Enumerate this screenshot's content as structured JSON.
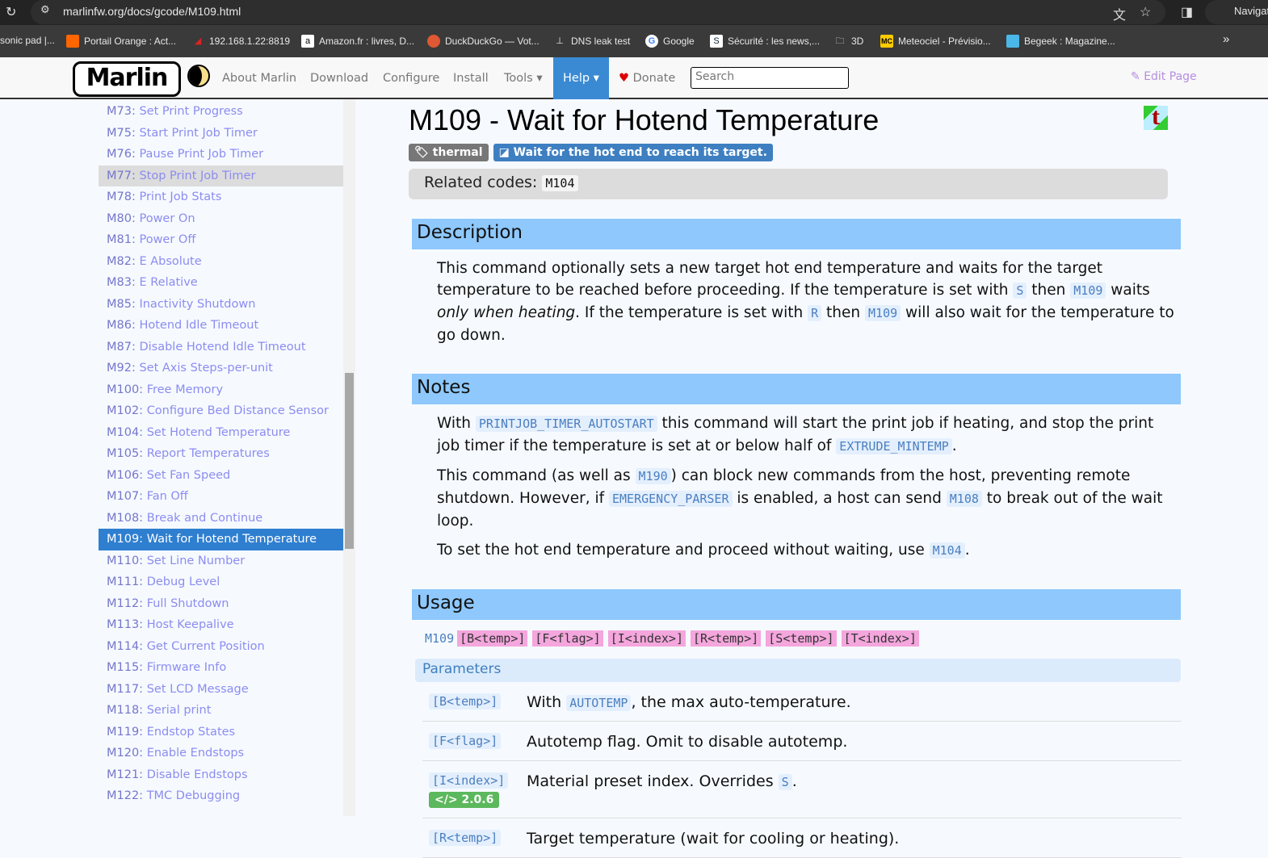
{
  "browser": {
    "url": "marlinfw.org/docs/gcode/M109.html",
    "profile_label": "Navigat",
    "bookmarks": [
      {
        "label": "sonic pad |..."
      },
      {
        "label": "Portail Orange : Act..."
      },
      {
        "label": "192.168.1.22:8819"
      },
      {
        "label": "Amazon.fr : livres, D..."
      },
      {
        "label": "DuckDuckGo — Vot..."
      },
      {
        "label": "DNS leak test"
      },
      {
        "label": "Google"
      },
      {
        "label": "Sécurité : les news,..."
      },
      {
        "label": "3D"
      },
      {
        "label": "Meteociel - Prévisio..."
      },
      {
        "label": "Begeek : Magazine..."
      }
    ],
    "more": "»"
  },
  "nav": {
    "logo": "Marlin",
    "items": [
      "About Marlin",
      "Download",
      "Configure",
      "Install",
      "Tools ▾"
    ],
    "help": "Help ▾",
    "donate": "Donate",
    "search_placeholder": "Search",
    "edit": "Edit Page"
  },
  "sidebar": [
    [
      "M73:",
      "Set Print Progress"
    ],
    [
      "M75:",
      "Start Print Job Timer"
    ],
    [
      "M76:",
      "Pause Print Job Timer"
    ],
    [
      "M77:",
      "Stop Print Job Timer"
    ],
    [
      "M78:",
      "Print Job Stats"
    ],
    [
      "M80:",
      "Power On"
    ],
    [
      "M81:",
      "Power Off"
    ],
    [
      "M82:",
      "E Absolute"
    ],
    [
      "M83:",
      "E Relative"
    ],
    [
      "M85:",
      "Inactivity Shutdown"
    ],
    [
      "M86:",
      "Hotend Idle Timeout"
    ],
    [
      "M87:",
      "Disable Hotend Idle Timeout"
    ],
    [
      "M92:",
      "Set Axis Steps-per-unit"
    ],
    [
      "M100:",
      "Free Memory"
    ],
    [
      "M102:",
      "Configure Bed Distance Sensor"
    ],
    [
      "M104:",
      "Set Hotend Temperature"
    ],
    [
      "M105:",
      "Report Temperatures"
    ],
    [
      "M106:",
      "Set Fan Speed"
    ],
    [
      "M107:",
      "Fan Off"
    ],
    [
      "M108:",
      "Break and Continue"
    ],
    [
      "M109:",
      "Wait for Hotend Temperature"
    ],
    [
      "M110:",
      "Set Line Number"
    ],
    [
      "M111:",
      "Debug Level"
    ],
    [
      "M112:",
      "Full Shutdown"
    ],
    [
      "M113:",
      "Host Keepalive"
    ],
    [
      "M114:",
      "Get Current Position"
    ],
    [
      "M115:",
      "Firmware Info"
    ],
    [
      "M117:",
      "Set LCD Message"
    ],
    [
      "M118:",
      "Serial print"
    ],
    [
      "M119:",
      "Endstop States"
    ],
    [
      "M120:",
      "Enable Endstops"
    ],
    [
      "M121:",
      "Disable Endstops"
    ],
    [
      "M122:",
      "TMC Debugging"
    ]
  ],
  "page": {
    "title": "M109 - Wait for Hotend Temperature",
    "tag": "thermal",
    "summary": "Wait for the hot end to reach its target.",
    "related_label": "Related codes:",
    "related_code": "M104",
    "desc_h": "Description",
    "desc": [
      "This command optionally sets a new target hot end temperature and waits for the target temperature to be reached before proceeding. If the temperature is set with ",
      "S",
      " then ",
      "M109",
      " waits ",
      "only when heating",
      ". If the temperature is set with ",
      "R",
      " then ",
      "M109",
      " will also wait for the temperature to go down."
    ],
    "notes_h": "Notes",
    "n1": [
      "With ",
      "PRINTJOB_TIMER_AUTOSTART",
      " this command will start the print job if heating, and stop the print job timer if the temperature is set at or below half of ",
      "EXTRUDE_MINTEMP",
      "."
    ],
    "n2": [
      "This command (as well as ",
      "M190",
      ") can block new commands from the host, preventing remote shutdown. However, if ",
      "EMERGENCY_PARSER",
      " is enabled, a host can send ",
      "M108",
      " to break out of the wait loop."
    ],
    "n3": [
      "To set the hot end temperature and proceed without waiting, use ",
      "M104",
      "."
    ],
    "usage_h": "Usage",
    "usage_cmd": "M109",
    "usage_args": [
      "[B<temp>]",
      "[F<flag>]",
      "[I<index>]",
      "[R<temp>]",
      "[S<temp>]",
      "[T<index>]"
    ],
    "params_h": "Parameters",
    "params": [
      {
        "name": "[B<temp>]",
        "d": [
          "With ",
          "AUTOTEMP",
          ", the max auto-temperature."
        ]
      },
      {
        "name": "[F<flag>]",
        "d": [
          "Autotemp flag. Omit to disable autotemp.",
          "",
          ""
        ]
      },
      {
        "name": "[I<index>]",
        "ver": "</> 2.0.6",
        "d": [
          "Material preset index. Overrides ",
          "S",
          "."
        ]
      },
      {
        "name": "[R<temp>]",
        "d": [
          "Target temperature (wait for cooling or heating).",
          "",
          ""
        ]
      }
    ]
  }
}
